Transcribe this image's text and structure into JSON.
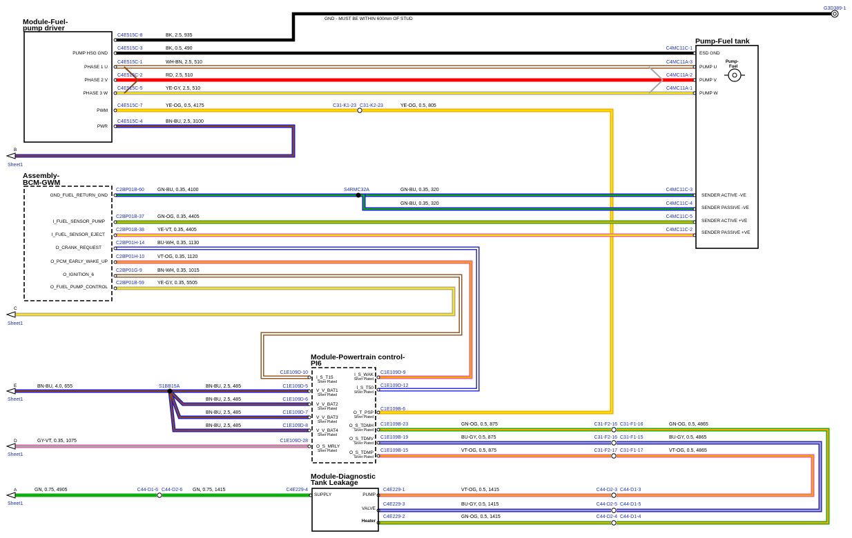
{
  "modules": {
    "pump_driver": {
      "title_line1": "Module-Fuel-",
      "title_line2": "pump driver",
      "pins": [
        "PUMP HSG GND",
        "PHASE 1 U",
        "PHASE 2 V",
        "PHASE 3 W",
        "PWM",
        "PWR"
      ]
    },
    "pump_tank": {
      "title": "Pump-Fuel tank",
      "icon_label_line1": "Pump-",
      "icon_label_line2": "Fuel",
      "pins": [
        "ESD GND",
        "PUMP U",
        "PUMP V",
        "PUMP W",
        "SENDER ACTIVE -VE",
        "SENDER PASSIVE -VE",
        "SENDER ACTIVE +VE",
        "SENDER PASSIVE +VE"
      ]
    },
    "bcm": {
      "title_line1": "Assembly-",
      "title_line2": "BCM-GWM",
      "pins": [
        "GND_FUEL_RETURN_GND",
        "I_FUEL_SENSOR_PUMP",
        "I_FUEL_SENSOR_EJECT",
        "O_CRANK_REQUEST",
        "O_PCM_EARLY_WAKE_UP",
        "O_IGNITION_6",
        "O_FUEL_PUMP_CONTROL"
      ]
    },
    "pcm": {
      "title_line1": "Module-Powertrain control-",
      "title_line2": "PI6",
      "left_pins": [
        "I_S_T15",
        "V_V_BAT1",
        "V_V_BAT2",
        "V_V_BAT3",
        "V_V_BAT4",
        "O_S_MRLY"
      ],
      "right_pins": [
        "I_S_WAK",
        "I_S_T50",
        "O_T_PSP",
        "O_S_TDMH",
        "O_S_TDMV",
        "O_S_TDMP"
      ],
      "plating": "Silver Plated"
    },
    "dtl": {
      "title_line1": "Module-Diagnostic",
      "title_line2": "Tank Leakage",
      "left_pins": [
        "SUPPLY"
      ],
      "right_pins": [
        "PUMP",
        "VALVE",
        "Heater"
      ]
    }
  },
  "ground": {
    "label": "G3D389-1",
    "note": "GND - MUST BE WITHIN 600mm OF STUD"
  },
  "splices": [
    "S4RMC32A",
    "S1BB15A"
  ],
  "sheet_refs": [
    {
      "letter": "B",
      "sheet": "Sheet1"
    },
    {
      "letter": "C",
      "sheet": "Sheet1"
    },
    {
      "letter": "E",
      "sheet": "Sheet1"
    },
    {
      "letter": "D",
      "sheet": "Sheet1"
    },
    {
      "letter": "A",
      "sheet": "Sheet1"
    }
  ],
  "colors": {
    "BK": "#000000",
    "WH": "#ffffff",
    "BN": "#8b4a13",
    "RD": "#ff0000",
    "YE": "#ffe600",
    "GY": "#a8a8a8",
    "OG": "#ffa500",
    "BU": "#1a1ae6",
    "GN": "#0fae0f",
    "VT": "#e060a0",
    "TEAL": "#007a7a"
  },
  "wires": [
    {
      "from": "C4E515C-8",
      "spec": "BK, 2.5, 935",
      "to": "",
      "colors": [
        "BK",
        "BK"
      ]
    },
    {
      "from": "C4E515C-3",
      "spec": "BK, 0.5, 490",
      "to": "C4MC11C-1",
      "colors": [
        "BK",
        "BK"
      ]
    },
    {
      "from": "C4E515C-1",
      "spec": "WH-BN, 2.5, 510",
      "to": "C4MC11A-3",
      "colors": [
        "WH",
        "BN"
      ]
    },
    {
      "from": "C4E515C-2",
      "spec": "RD, 2.5, 510",
      "to": "C4MC11A-2",
      "colors": [
        "RD",
        "RD"
      ]
    },
    {
      "from": "C4E515C-5",
      "spec": "YE-GY, 2.5, 510",
      "to": "C4MC11A-1",
      "colors": [
        "YE",
        "GY"
      ]
    },
    {
      "from": "C4E515C-7",
      "spec": "YE-OG, 0.5, 4175",
      "to": "C31-K1-23",
      "colors": [
        "YE",
        "OG"
      ]
    },
    {
      "from": "C31-K2-23",
      "spec": "YE-OG, 0.5, 805",
      "to": "C1E109B-6",
      "colors": [
        "YE",
        "OG"
      ]
    },
    {
      "from": "C4E515C-4",
      "spec": "BN-BU, 2.5, 3100",
      "to": "B",
      "colors": [
        "BN",
        "BU"
      ]
    },
    {
      "from": "C2BP01B-60",
      "spec": "GN-BU, 0.35, 4100",
      "to": "S4RMC32A",
      "colors": [
        "GN",
        "BU"
      ]
    },
    {
      "from": "S4RMC32A",
      "spec": "GN-BU, 0.35, 320",
      "to": "C4MC11C-3",
      "colors": [
        "GN",
        "BU"
      ]
    },
    {
      "from": "S4RMC32A",
      "spec": "GN-BU, 0.35, 320",
      "to": "C4MC11C-4",
      "colors": [
        "GN",
        "BU"
      ]
    },
    {
      "from": "C2BP01B-37",
      "spec": "GN-OG, 0.35, 4405",
      "to": "C4MC11C-5",
      "colors": [
        "GN",
        "OG"
      ]
    },
    {
      "from": "C2BP01B-38",
      "spec": "YE-VT, 0.35, 4405",
      "to": "C4MC11C-2",
      "colors": [
        "YE",
        "VT"
      ]
    },
    {
      "from": "C2BP01H-14",
      "spec": "BU-WH, 0.35, 1130",
      "to": "C1E109D-12",
      "colors": [
        "BU",
        "WH"
      ]
    },
    {
      "from": "C2BP01H-10",
      "spec": "VT-OG, 0.35, 1120",
      "to": "C1E109D-9",
      "colors": [
        "VT",
        "OG"
      ]
    },
    {
      "from": "C2BP01G-9",
      "spec": "BN-WH, 0.35, 1015",
      "to": "C1E109D-10",
      "colors": [
        "BN",
        "WH"
      ]
    },
    {
      "from": "C2BP01B-59",
      "spec": "YE-GY, 0.35, 5505",
      "to": "C",
      "colors": [
        "YE",
        "GY"
      ]
    },
    {
      "from": "E",
      "spec": "BN-BU, 4.0, 655",
      "to": "S1BB15A",
      "colors": [
        "BN",
        "BU"
      ]
    },
    {
      "from": "S1BB15A",
      "spec": "BN-BU, 2.5, 485",
      "to": "C1E109D-5",
      "colors": [
        "BN",
        "BU"
      ]
    },
    {
      "from": "S1BB15A",
      "spec": "BN-BU, 2.5, 485",
      "to": "C1E109D-6",
      "colors": [
        "BN",
        "BU"
      ]
    },
    {
      "from": "S1BB15A",
      "spec": "BN-BU, 2.5, 485",
      "to": "C1E109D-7",
      "colors": [
        "BN",
        "BU"
      ]
    },
    {
      "from": "S1BB15A",
      "spec": "BN-BU, 2.5, 485",
      "to": "C1E109D-8",
      "colors": [
        "BN",
        "BU"
      ]
    },
    {
      "from": "D",
      "spec": "GY-VT, 0.35, 1075",
      "to": "C1E109D-28",
      "colors": [
        "GY",
        "VT"
      ]
    },
    {
      "from": "C1E109B-23",
      "spec": "GN-OG, 0.5, 875",
      "to": "C31-F2-16",
      "colors": [
        "GN",
        "OG"
      ]
    },
    {
      "from": "C1E109B-19",
      "spec": "BU-GY, 0.5, 875",
      "to": "C31-F2-16",
      "colors": [
        "BU",
        "GY"
      ]
    },
    {
      "from": "C1E109B-15",
      "spec": "VT-OG, 0.5, 875",
      "to": "C31-F2-17",
      "colors": [
        "VT",
        "OG"
      ]
    },
    {
      "from": "C31-F1-16",
      "spec": "GN-OG, 0.5, 4865",
      "to": "C44-D1-4",
      "colors": [
        "GN",
        "OG"
      ]
    },
    {
      "from": "C31-F1-15",
      "spec": "BU-GY, 0.5, 4865",
      "to": "C44-D1-5",
      "colors": [
        "BU",
        "GY"
      ]
    },
    {
      "from": "C31-F1-17",
      "spec": "VT-OG, 0.5, 4865",
      "to": "C44-D1-3",
      "colors": [
        "VT",
        "OG"
      ]
    },
    {
      "from": "A",
      "spec": "GN, 0.75, 4905",
      "to": "C44-D1-6",
      "colors": [
        "GN",
        "GN"
      ]
    },
    {
      "from": "C44-D2-6",
      "spec": "GN, 0.75, 1415",
      "to": "C4E229-4",
      "colors": [
        "GN",
        "GN"
      ]
    },
    {
      "from": "C4E229-1",
      "spec": "VT-OG, 0.5, 1415",
      "to": "C44-D2-3",
      "colors": [
        "VT",
        "OG"
      ]
    },
    {
      "from": "C4E229-3",
      "spec": "BU-GY, 0.5, 1415",
      "to": "C44-D2-5",
      "colors": [
        "BU",
        "GY"
      ]
    },
    {
      "from": "C4E229-2",
      "spec": "GN-OG, 0.5, 1415",
      "to": "C44-D2-4",
      "colors": [
        "GN",
        "OG"
      ]
    }
  ],
  "connector_labels": {
    "pcm_left": [
      "C1E109D-10",
      "C1E109D-5",
      "C1E109D-6",
      "C1E109D-7",
      "C1E109D-8",
      "C1E109D-28"
    ],
    "pcm_right": [
      "C1E109D-9",
      "C1E109D-12",
      "C1E109B-6",
      "C1E109B-23",
      "C1E109B-19",
      "C1E109B-15"
    ],
    "inline_f": [
      "C31-F2-16",
      "C31-F1-16",
      "C31-F2-16",
      "C31-F1-15",
      "C31-F2-17",
      "C31-F1-17"
    ],
    "inline_d": [
      "C44-D2-3",
      "C44-D1-3",
      "C44-D2-5",
      "C44-D1-5",
      "C44-D2-4",
      "C44-D1-4"
    ],
    "inline_a": [
      "C44-D1-6",
      "C44-D2-6"
    ],
    "inline_k": [
      "C31-K1-23",
      "C31-K2-23"
    ],
    "dtl": [
      "C4E229-4",
      "C4E229-1",
      "C4E229-3",
      "C4E229-2"
    ]
  }
}
